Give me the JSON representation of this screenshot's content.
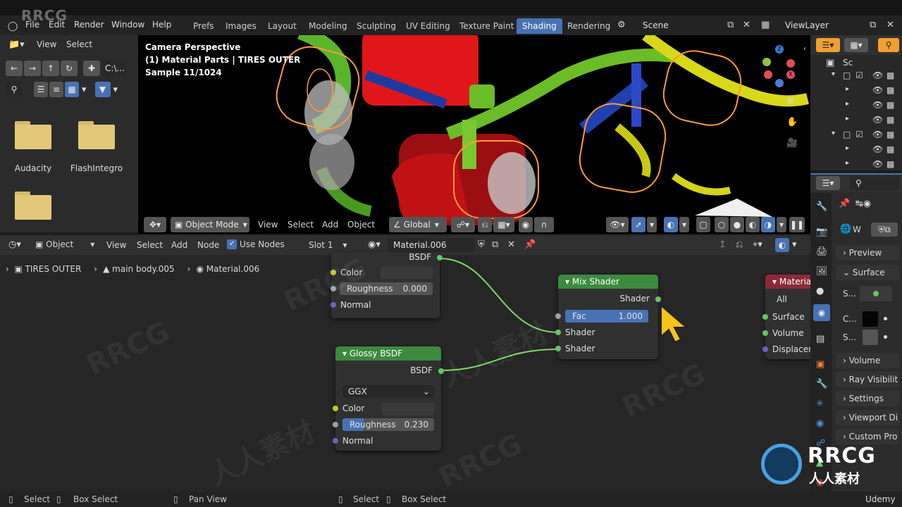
{
  "menu": [
    "File",
    "Edit",
    "Render",
    "Window",
    "Help"
  ],
  "workspaces": [
    {
      "label": "Prefs",
      "active": false
    },
    {
      "label": "Images",
      "active": false
    },
    {
      "label": "Layout",
      "active": false
    },
    {
      "label": "Modeling",
      "active": false
    },
    {
      "label": "Sculpting",
      "active": false
    },
    {
      "label": "UV Editing",
      "active": false
    },
    {
      "label": "Texture Paint",
      "active": false
    },
    {
      "label": "Shading",
      "active": true
    },
    {
      "label": "Rendering",
      "active": false
    }
  ],
  "scene": {
    "name": "Scene",
    "view_layer": "ViewLayer"
  },
  "file_browser": {
    "view_label": "View",
    "select_label": "Select",
    "path_label": "C:\\...",
    "folders": [
      "Audacity",
      "FlashIntegro",
      ""
    ]
  },
  "viewport": {
    "info_lines": [
      "Camera Perspective",
      "(1) Material Parts | TIRES OUTER",
      "Sample 11/1024"
    ],
    "mode": "Object Mode",
    "menu": [
      "View",
      "Select",
      "Add",
      "Object"
    ],
    "transform": "Global"
  },
  "node_editor": {
    "type": "Object",
    "menu": [
      "View",
      "Select",
      "Add",
      "Node"
    ],
    "use_nodes_label": "Use Nodes",
    "slot": "Slot 1",
    "material": "Material.006",
    "breadcrumb": [
      "TIRES OUTER",
      "main body.005",
      "Material.006"
    ],
    "nodes": {
      "top_bsdf": {
        "output": "BSDF",
        "inputs": [
          "Color",
          "Roughness",
          "Normal"
        ],
        "roughness_value": "0.000"
      },
      "glossy": {
        "title": "Glossy BSDF",
        "output": "BSDF",
        "distribution": "GGX",
        "inputs": [
          "Color",
          "Roughness",
          "Normal"
        ],
        "roughness_value": "0.230",
        "roughness_fill": 0.23
      },
      "mix": {
        "title": "Mix Shader",
        "output": "Shader",
        "fac_label": "Fac",
        "fac_value": "1.000",
        "inputs": [
          "Shader",
          "Shader"
        ]
      },
      "output": {
        "title": "Materia",
        "target": "All",
        "inputs": [
          "Surface",
          "Volume",
          "Displacem"
        ]
      }
    }
  },
  "outliner": {
    "root": "Sc"
  },
  "properties": {
    "sections": [
      "Preview",
      "Surface",
      "Volume",
      "Ray Visibilit",
      "Settings",
      "Viewport Di",
      "Custom Pro"
    ],
    "world_label": "W",
    "surface_rows": [
      "S...",
      "C...",
      "S..."
    ]
  },
  "statusbar": [
    "Select",
    "Box Select",
    "Pan View",
    "Select",
    "Box Select"
  ],
  "branding": {
    "watermark": "RRCG",
    "watermark_cn": "人人素材",
    "udemy": "Udemy"
  },
  "colors": {
    "accent": "#4772b3",
    "node_green": "#3d8a3e",
    "output_red": "#8a2a36",
    "shader_socket": "#63c763"
  }
}
